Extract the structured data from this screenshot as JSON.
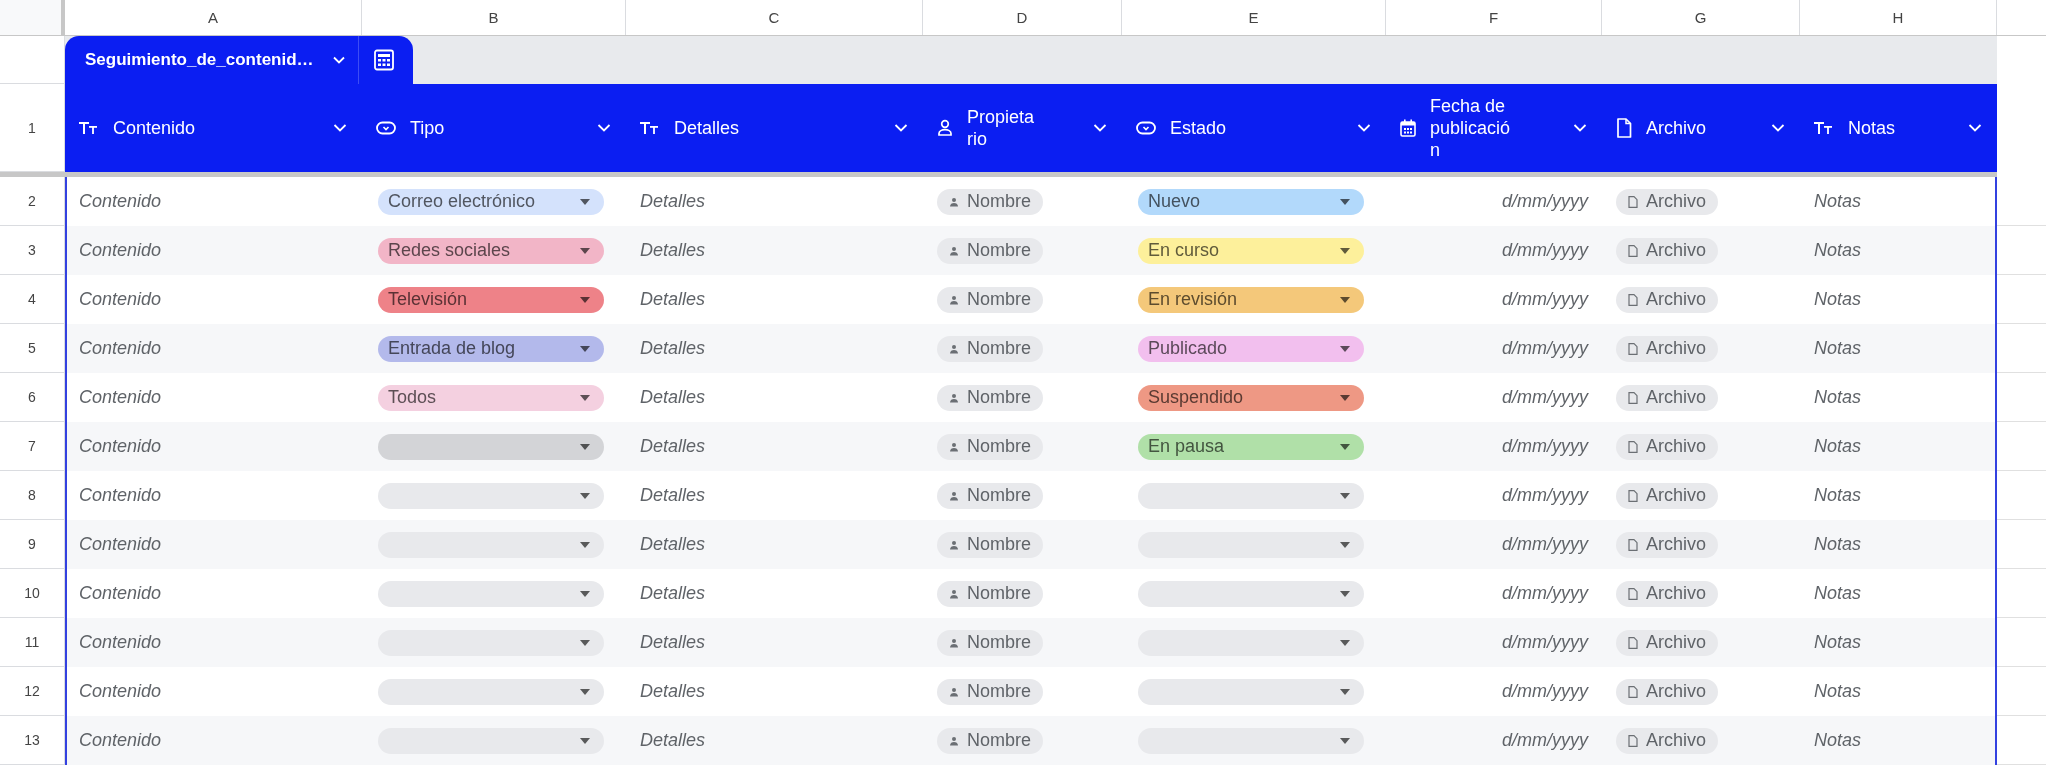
{
  "column_letters": [
    "A",
    "B",
    "C",
    "D",
    "E",
    "F",
    "G",
    "H"
  ],
  "sheet_tab": {
    "title": "Seguimiento_de_contenid…"
  },
  "header": {
    "row_number": "1",
    "columns": [
      {
        "kind": "text",
        "lines": [
          "Contenido"
        ]
      },
      {
        "kind": "dropdown",
        "lines": [
          "Tipo"
        ]
      },
      {
        "kind": "text",
        "lines": [
          "Detalles"
        ]
      },
      {
        "kind": "person",
        "lines": [
          "Propieta",
          "rio"
        ]
      },
      {
        "kind": "dropdown",
        "lines": [
          "Estado"
        ]
      },
      {
        "kind": "date",
        "lines": [
          "Fecha de",
          "publicació",
          "n"
        ]
      },
      {
        "kind": "file",
        "lines": [
          "Archivo"
        ]
      },
      {
        "kind": "text",
        "lines": [
          "Notas"
        ]
      }
    ]
  },
  "rows": [
    {
      "row_number": "2",
      "contenido": "Contenido",
      "tipo": {
        "label": "Correo electrónico",
        "color": "#d4e2fc"
      },
      "detalles": "Detalles",
      "propietario": "Nombre",
      "estado": {
        "label": "Nuevo",
        "color": "#b2d9fb"
      },
      "fecha": "d/mm/yyyy",
      "archivo": "Archivo",
      "notas": "Notas"
    },
    {
      "row_number": "3",
      "contenido": "Contenido",
      "tipo": {
        "label": "Redes sociales",
        "color": "#f2b5c7"
      },
      "detalles": "Detalles",
      "propietario": "Nombre",
      "estado": {
        "label": "En curso",
        "color": "#fdf09b"
      },
      "fecha": "d/mm/yyyy",
      "archivo": "Archivo",
      "notas": "Notas"
    },
    {
      "row_number": "4",
      "contenido": "Contenido",
      "tipo": {
        "label": "Televisión",
        "color": "#ee8288"
      },
      "detalles": "Detalles",
      "propietario": "Nombre",
      "estado": {
        "label": "En revisión",
        "color": "#f4c87a"
      },
      "fecha": "d/mm/yyyy",
      "archivo": "Archivo",
      "notas": "Notas"
    },
    {
      "row_number": "5",
      "contenido": "Contenido",
      "tipo": {
        "label": "Entrada de blog",
        "color": "#b3b9eb"
      },
      "detalles": "Detalles",
      "propietario": "Nombre",
      "estado": {
        "label": "Publicado",
        "color": "#f2bfee"
      },
      "fecha": "d/mm/yyyy",
      "archivo": "Archivo",
      "notas": "Notas"
    },
    {
      "row_number": "6",
      "contenido": "Contenido",
      "tipo": {
        "label": "Todos",
        "color": "#f4d0e0"
      },
      "detalles": "Detalles",
      "propietario": "Nombre",
      "estado": {
        "label": "Suspendido",
        "color": "#ee9884"
      },
      "fecha": "d/mm/yyyy",
      "archivo": "Archivo",
      "notas": "Notas"
    },
    {
      "row_number": "7",
      "contenido": "Contenido",
      "tipo": {
        "color": "#d3d4d7"
      },
      "detalles": "Detalles",
      "propietario": "Nombre",
      "estado": {
        "label": "En pausa",
        "color": "#b0e0a8"
      },
      "fecha": "d/mm/yyyy",
      "archivo": "Archivo",
      "notas": "Notas"
    },
    {
      "row_number": "8",
      "contenido": "Contenido",
      "tipo": {
        "color": "#e8e9ec"
      },
      "detalles": "Detalles",
      "propietario": "Nombre",
      "estado": {
        "color": "#e8e9ec"
      },
      "fecha": "d/mm/yyyy",
      "archivo": "Archivo",
      "notas": "Notas"
    },
    {
      "row_number": "9",
      "contenido": "Contenido",
      "tipo": {
        "color": "#e8e9ec"
      },
      "detalles": "Detalles",
      "propietario": "Nombre",
      "estado": {
        "color": "#e8e9ec"
      },
      "fecha": "d/mm/yyyy",
      "archivo": "Archivo",
      "notas": "Notas"
    },
    {
      "row_number": "10",
      "contenido": "Contenido",
      "tipo": {
        "color": "#e8e9ec"
      },
      "detalles": "Detalles",
      "propietario": "Nombre",
      "estado": {
        "color": "#e8e9ec"
      },
      "fecha": "d/mm/yyyy",
      "archivo": "Archivo",
      "notas": "Notas"
    },
    {
      "row_number": "11",
      "contenido": "Contenido",
      "tipo": {
        "color": "#e8e9ec"
      },
      "detalles": "Detalles",
      "propietario": "Nombre",
      "estado": {
        "color": "#e8e9ec"
      },
      "fecha": "d/mm/yyyy",
      "archivo": "Archivo",
      "notas": "Notas"
    },
    {
      "row_number": "12",
      "contenido": "Contenido",
      "tipo": {
        "color": "#e8e9ec"
      },
      "detalles": "Detalles",
      "propietario": "Nombre",
      "estado": {
        "color": "#e8e9ec"
      },
      "fecha": "d/mm/yyyy",
      "archivo": "Archivo",
      "notas": "Notas"
    },
    {
      "row_number": "13",
      "contenido": "Contenido",
      "tipo": {
        "color": "#e8e9ec"
      },
      "detalles": "Detalles",
      "propietario": "Nombre",
      "estado": {
        "color": "#e8e9ec"
      },
      "fecha": "d/mm/yyyy",
      "archivo": "Archivo",
      "notas": "Notas"
    }
  ]
}
